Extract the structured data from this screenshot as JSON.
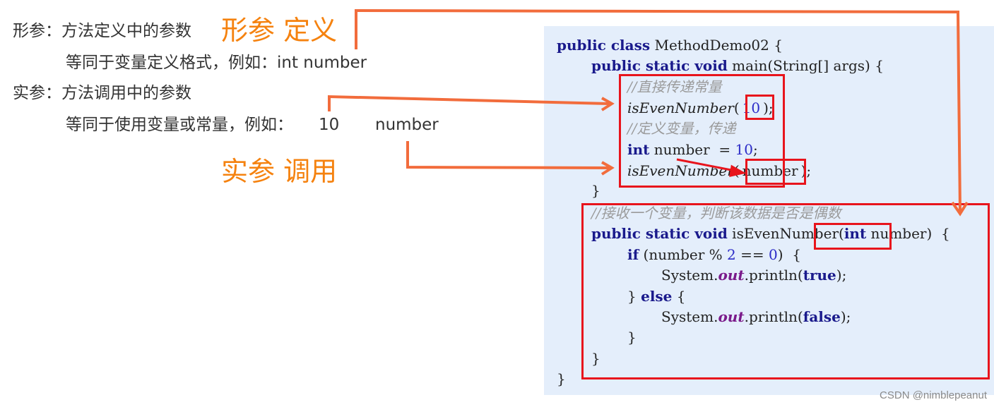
{
  "left": {
    "formal": {
      "label": "形参：方法定义中的参数",
      "detail": "等同于变量定义格式，例如：int number",
      "big_label": "形参 定义"
    },
    "actual": {
      "label": "实参：方法调用中的参数",
      "detail_prefix": "等同于使用变量或常量，例如：",
      "example_const": "10",
      "example_var": "number",
      "big_label": "实参 调用"
    }
  },
  "code": {
    "line1": {
      "kw": "public class",
      "rest": " MethodDemo02 {"
    },
    "line2": {
      "kw": "public static void",
      "rest": " main(String[] args) {"
    },
    "line3": {
      "comment": "//直接传递常量"
    },
    "line4": {
      "call": "isEvenNumber",
      "open": "(",
      "arg": "10",
      "close": ");"
    },
    "line5": {
      "comment": "//定义变量，传递"
    },
    "line6": {
      "kw": "int",
      "name": " number  = ",
      "val": "10",
      "end": ";"
    },
    "line7": {
      "call": "isEvenNumber",
      "open": "(",
      "arg": "number",
      "close": ");"
    },
    "line8": {
      "text": "}"
    },
    "line9": {
      "comment": "//接收一个变量，判断该数据是否是偶数"
    },
    "line10": {
      "kw": "public static void",
      "name": " isEvenNumber(",
      "param_kw": "int",
      "param": " number",
      "end": ")  {"
    },
    "line11": {
      "kw": "if",
      "pre": " (number % ",
      "n2": "2",
      "eq": " == ",
      "n0": "0",
      "end": ")  {"
    },
    "line12": {
      "pre": "System.",
      "field": "out",
      "call": ".println(",
      "val": "true",
      "end": ");"
    },
    "line13": {
      "pre": "} ",
      "kw": "else",
      "end": " {"
    },
    "line14": {
      "pre": "System.",
      "field": "out",
      "call": ".println(",
      "val": "false",
      "end": ");"
    },
    "line15": {
      "text": "}"
    },
    "line16": {
      "text": "}"
    },
    "line17": {
      "text": "}"
    }
  },
  "colors": {
    "annotation_orange": "#f5820f",
    "connector": "#f26c3c",
    "highlight_box": "#e8141c",
    "code_bg": "#e4eefb"
  },
  "watermark": "CSDN @nimblepeanut"
}
